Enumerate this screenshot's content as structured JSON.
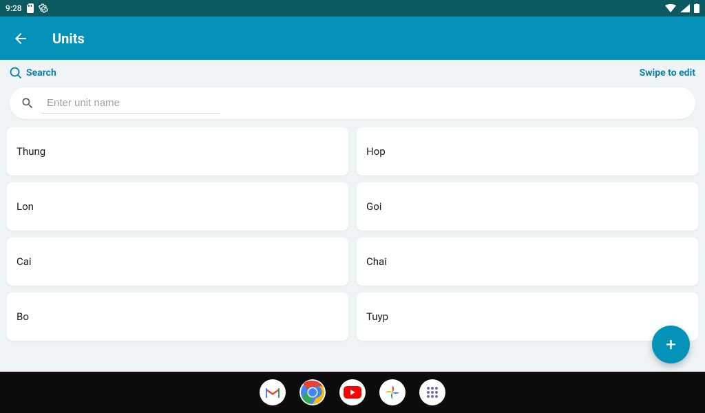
{
  "status": {
    "time": "9:28"
  },
  "app_bar": {
    "title": "Units"
  },
  "sub_bar": {
    "search_label": "Search",
    "hint": "Swipe to edit"
  },
  "search": {
    "placeholder": "Enter unit name"
  },
  "units": [
    {
      "name": "Thung"
    },
    {
      "name": "Hop"
    },
    {
      "name": "Lon"
    },
    {
      "name": "Goi"
    },
    {
      "name": "Cai"
    },
    {
      "name": "Chai"
    },
    {
      "name": "Bo"
    },
    {
      "name": "Tuyp"
    }
  ],
  "fab": {
    "glyph": "+"
  },
  "nav": {
    "items": [
      {
        "id": "gmail"
      },
      {
        "id": "chrome"
      },
      {
        "id": "youtube"
      },
      {
        "id": "photos"
      },
      {
        "id": "apps"
      }
    ]
  }
}
